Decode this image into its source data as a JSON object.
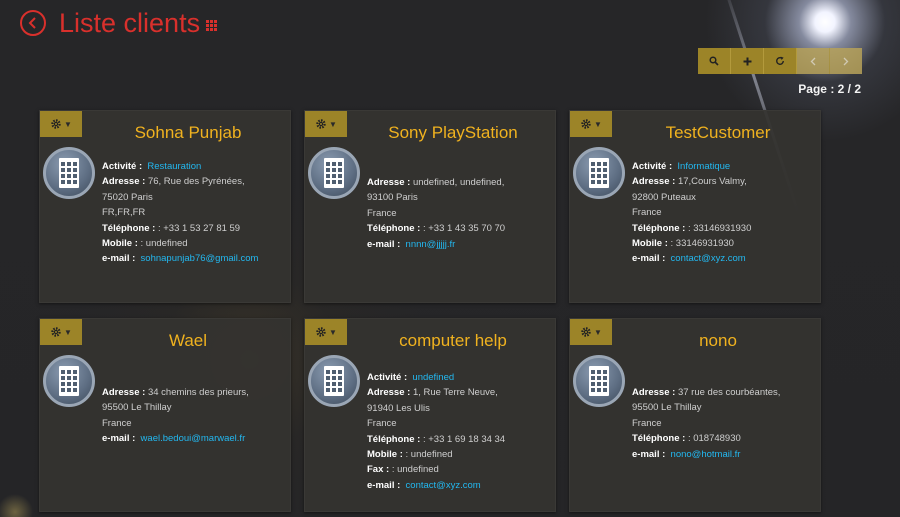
{
  "header": {
    "title": "Liste clients"
  },
  "toolbar": {
    "buttons": [
      {
        "icon": "search-icon"
      },
      {
        "icon": "plus-icon"
      },
      {
        "icon": "refresh-icon"
      },
      {
        "icon": "chevron-left-icon"
      },
      {
        "icon": "chevron-right-icon"
      }
    ],
    "page_info": "Page : 2 / 2"
  },
  "labels": {
    "activite": "Activité :",
    "adresse": "Adresse :",
    "telephone": "Téléphone :",
    "mobile": "Mobile :",
    "fax": "Fax :",
    "email": "e-mail :"
  },
  "clients": [
    {
      "name": "Sohna Punjab",
      "activite": "Restauration",
      "adresse": "76, Rue des Pyrénées,",
      "adresse2": "75020 Paris",
      "adresse3": "FR,FR,FR",
      "telephone": ": +33 1 53 27 81 59",
      "mobile": ": undefined",
      "email": "sohnapunjab76@gmail.com"
    },
    {
      "name": "Sony PlayStation",
      "adresse": "undefined, undefined,",
      "adresse2": "93100 Paris",
      "adresse3": "France",
      "telephone": ": +33 1 43 35 70 70",
      "email": "nnnn@jjjjj.fr"
    },
    {
      "name": "TestCustomer",
      "activite": "Informatique",
      "adresse": "17,Cours Valmy,",
      "adresse2": "92800 Puteaux",
      "adresse3": "France",
      "telephone": ": 33146931930",
      "mobile": ": 33146931930",
      "email": "contact@xyz.com"
    },
    {
      "name": "Wael",
      "adresse": "34 chemins des prieurs,",
      "adresse2": "95500 Le Thillay",
      "adresse3": "France",
      "email": "wael.bedoui@marwael.fr"
    },
    {
      "name": "computer help",
      "activite": "undefined",
      "adresse": "1, Rue Terre Neuve,",
      "adresse2": "91940 Les Ulis",
      "adresse3": "France",
      "telephone": ": +33 1 69 18 34 34",
      "mobile": ": undefined",
      "fax": ": undefined",
      "email": "contact@xyz.com"
    },
    {
      "name": "nono",
      "adresse": "37 rue des courbéantes,",
      "adresse2": "95500 Le Thillay",
      "adresse3": "France",
      "telephone": ": 018748930",
      "email": "nono@hotmail.fr"
    }
  ],
  "colors": {
    "accent_red": "#d9302c",
    "gold": "#9c8428",
    "name_orange": "#f0b21f",
    "link_blue": "#23b8f0",
    "background": "#232325"
  }
}
